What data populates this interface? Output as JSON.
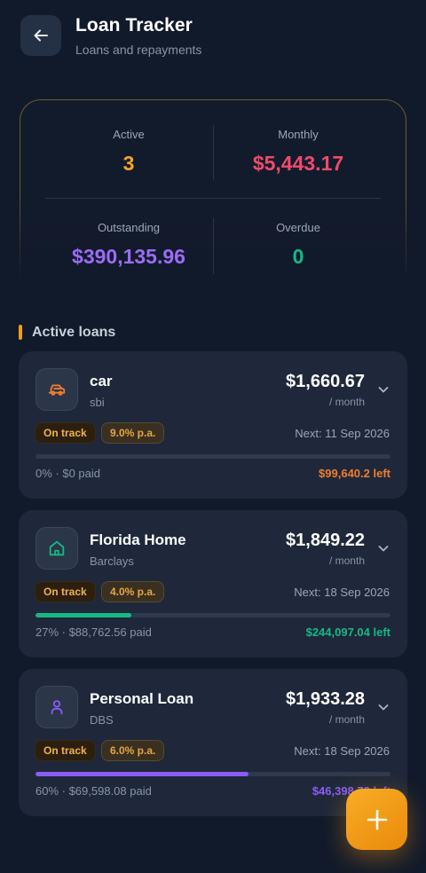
{
  "header": {
    "title": "Loan Tracker",
    "subtitle": "Loans and repayments"
  },
  "summary": {
    "active_label": "Active",
    "active_value": "3",
    "monthly_label": "Monthly",
    "monthly_value": "$5,443.17",
    "outstanding_label": "Outstanding",
    "outstanding_value": "$390,135.96",
    "overdue_label": "Overdue",
    "overdue_value": "0"
  },
  "section": {
    "title": "Active loans"
  },
  "loans": [
    {
      "name": "car",
      "lender": "sbi",
      "amount": "$1,660.67",
      "per": "/ month",
      "status": "On track",
      "rate": "9.0% p.a.",
      "next": "Next: 11 Sep 2026",
      "progress": 0,
      "paid": "0% · $0 paid",
      "left": "$99,640.2 left",
      "icon": "car-icon",
      "accent": "#f07d2d"
    },
    {
      "name": "Florida Home",
      "lender": "Barclays",
      "amount": "$1,849.22",
      "per": "/ month",
      "status": "On track",
      "rate": "4.0% p.a.",
      "next": "Next: 18 Sep 2026",
      "progress": 27,
      "paid": "27% · $88,762.56 paid",
      "left": "$244,097.04 left",
      "icon": "home-icon",
      "accent": "#17b885"
    },
    {
      "name": "Personal Loan",
      "lender": "DBS",
      "amount": "$1,933.28",
      "per": "/ month",
      "status": "On track",
      "rate": "6.0% p.a.",
      "next": "Next: 18 Sep 2026",
      "progress": 60,
      "paid": "60% · $69,598.08 paid",
      "left": "$46,398.72 left",
      "icon": "person-icon",
      "accent": "#8b5cf6"
    }
  ],
  "colors": {
    "active": "#f5a524",
    "monthly": "#ef4b6a",
    "outstanding": "#9b6cf5",
    "overdue": "#17b885"
  }
}
